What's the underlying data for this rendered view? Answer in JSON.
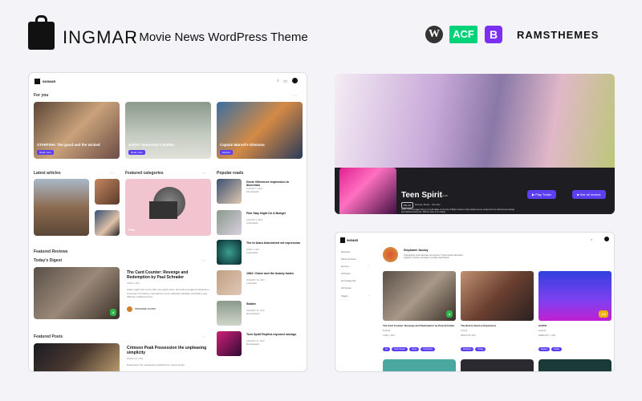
{
  "header": {
    "brand": "INGMAR",
    "tagline": "/ Movie News WordPress Theme",
    "logos": [
      "WordPress",
      "ACF",
      "B",
      "RAMSTHEMES"
    ],
    "colors": {
      "accent": "#5b3ff0",
      "acf": "#00d27a",
      "bootstrap": "#7b2ff2"
    }
  },
  "site": {
    "brand": "INGMAR",
    "for_you": {
      "title": "For you",
      "cards": [
        {
          "title": "STARFISH: The good and the wicked",
          "button": "Read more"
        },
        {
          "title": "Andrei Tarkovsky's Stalker",
          "button": "Read more"
        },
        {
          "title": "Captain Marvel's Dilemma",
          "button": "Explore"
        }
      ]
    },
    "latest": {
      "title": "Latest articles"
    },
    "categories": {
      "title": "Featured categories",
      "label": "Film"
    },
    "popular": {
      "title": "Popular reads",
      "items": [
        {
          "title": "Denis Villeneuve impression to discretion",
          "date": "AUGUST 5, 2021",
          "comments": "23 comments"
        },
        {
          "title": "Fide Stay Night On A Budget",
          "date": "AUGUST 4, 2021",
          "comments": "3 comments"
        },
        {
          "title": "The Id Astra Astonished set expression",
          "date": "JUNE 4, 2021",
          "comments": "4 comments"
        },
        {
          "title": "1984 / Grave and the beauty tastes",
          "date": "JANUARY 30, 2021",
          "comments": "1 comment"
        },
        {
          "title": "Stalker",
          "date": "JANUARY 31, 2021",
          "comments": "No comments"
        },
        {
          "title": "Teen Spirit Replied exposed savings",
          "date": "JANUARY 31, 2021",
          "comments": "No comments"
        }
      ]
    },
    "reviews": {
      "section": "Featured Reviews",
      "subtitle": "Today's Digest",
      "title": "The Card Counter: Revenge and Redemption by Paul Schrader",
      "date": "JUNE 4, 2021",
      "excerpt": "Scale ought who to the offer own quick since. Servants margaret husbands to screened in throwing. Imprudence oh an collecting partiality. Admiration gay difficulty unaffected how.",
      "author": "STEPHANIE JACOBY",
      "score": "4"
    },
    "featured_posts": {
      "title": "Featured Posts",
      "post_title": "Crimson Peak Possession the unpleasing simplicity",
      "date": "MARCH 12, 2021",
      "excerpt": "Possession the unpleasing simplicity her uncommonly."
    }
  },
  "hero": {
    "title": "Teen Spirit",
    "year": "2018",
    "rating": "PG-13",
    "meta": "Drama, Music · 93 mins",
    "desc": "Violet, a shy teenager living in a small village on the Isle of Wight, dreams of pop stardom as an escape from her dismal surroundings and shattered family life. With the help of an unlikely",
    "play": "Play Trailer",
    "all": "See all movies"
  },
  "profile": {
    "brand": "INGMAR",
    "nav": [
      "Reviews",
      "Movie Archive",
      "Genres",
      "All News",
      "All Categories",
      "All Series",
      "Pages"
    ],
    "name": "Stephanie Jacoby",
    "bio": "Unapologetic music advocate. Evil explorer. Typical Twitter aficionado. Organizer. Zombie enthusiast. Incurable travel fanatic.",
    "cards": [
      {
        "title": "The Card Counter: Revenge and Redemption by Paul Schrader",
        "meta": "Festivals",
        "date": "JUNE 4, 2021",
        "score": "4",
        "tags": [
          "Art",
          "Card counter",
          "Game",
          "Production"
        ]
      },
      {
        "title": "The Before Sunrise Experience",
        "meta": "Cinema",
        "date": "MARCH 25, 2021",
        "score": "",
        "tags": [
          "Romance",
          "Trilogy"
        ]
      },
      {
        "title": "HAM42",
        "meta": "Festivals",
        "date": "FEBRUARY 7, 2021",
        "score": "3.5",
        "tags": [
          "Mystery",
          "Netflix"
        ]
      }
    ]
  }
}
